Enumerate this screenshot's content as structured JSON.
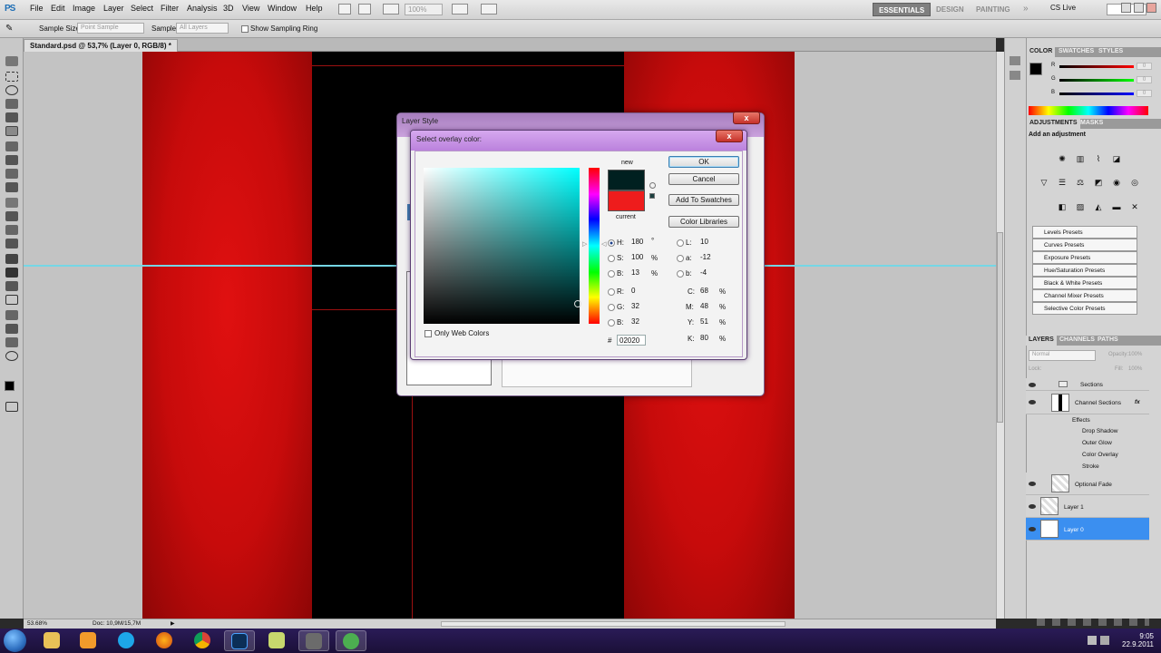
{
  "app": {
    "logo": "PS"
  },
  "menu": [
    "File",
    "Edit",
    "Image",
    "Layer",
    "Select",
    "Filter",
    "Analysis",
    "3D",
    "View",
    "Window",
    "Help"
  ],
  "menubar": {
    "zoom_value": "100%",
    "workspaces": [
      "ESSENTIALS",
      "DESIGN",
      "PAINTING"
    ],
    "more": "»",
    "cs_live": "CS Live"
  },
  "options": {
    "sample_size_label": "Sample Size:",
    "sample_size_value": "Point Sample",
    "sample_label": "Sample:",
    "sample_value": "All Layers",
    "show_ring_label": "Show Sampling Ring"
  },
  "document": {
    "tab": "Standard.psd @ 53,7% (Layer 0, RGB/8) *"
  },
  "status": {
    "zoom": "53.68%",
    "doc": "Doc: 10,9M/15,7M"
  },
  "panels": {
    "color_tabs": [
      "COLOR",
      "SWATCHES",
      "STYLES"
    ],
    "color_channels": [
      {
        "label": "R",
        "value": "0"
      },
      {
        "label": "G",
        "value": "0"
      },
      {
        "label": "B",
        "value": "0"
      }
    ],
    "adjustments_tabs": [
      "ADJUSTMENTS",
      "MASKS"
    ],
    "adjustments_title": "Add an adjustment",
    "presets": [
      "Levels Presets",
      "Curves Presets",
      "Exposure Presets",
      "Hue/Saturation Presets",
      "Black & White Presets",
      "Channel Mixer Presets",
      "Selective Color Presets"
    ],
    "layers_tabs": [
      "LAYERS",
      "CHANNELS",
      "PATHS"
    ],
    "blend_mode": "Normal",
    "opacity_label": "Opacity:",
    "opacity_value": "100%",
    "fill_label": "Fill:",
    "fill_value": "100%",
    "lock_label": "Lock:",
    "layers": {
      "group": "Sections",
      "channel_sections": "Channel Sections",
      "fx": "fx",
      "effects": "Effects",
      "effect_items": [
        "Drop Shadow",
        "Outer Glow",
        "Color Overlay",
        "Stroke"
      ],
      "optional_fade": "Optional Fade",
      "layer1": "Layer 1",
      "layer0": "Layer 0"
    }
  },
  "layer_style": {
    "title": "Layer Style",
    "close": "x",
    "blur_tab": "Color Overlay"
  },
  "picker": {
    "title": "Select overlay color:",
    "close": "x",
    "ok": "OK",
    "cancel": "Cancel",
    "add_swatches": "Add To Swatches",
    "color_libraries": "Color Libraries",
    "new_label": "new",
    "current_label": "current",
    "new_color": "#002020",
    "current_color": "#ee1c1c",
    "only_web": "Only Web Colors",
    "hsb": [
      {
        "label": "H:",
        "value": "180",
        "unit": "°"
      },
      {
        "label": "S:",
        "value": "100",
        "unit": "%"
      },
      {
        "label": "B:",
        "value": "13",
        "unit": "%"
      }
    ],
    "rgb": [
      {
        "label": "R:",
        "value": "0"
      },
      {
        "label": "G:",
        "value": "32"
      },
      {
        "label": "B:",
        "value": "32"
      }
    ],
    "lab": [
      {
        "label": "L:",
        "value": "10"
      },
      {
        "label": "a:",
        "value": "-12"
      },
      {
        "label": "b:",
        "value": "-4"
      }
    ],
    "cmyk": [
      {
        "label": "C:",
        "value": "68",
        "unit": "%"
      },
      {
        "label": "M:",
        "value": "48",
        "unit": "%"
      },
      {
        "label": "Y:",
        "value": "51",
        "unit": "%"
      },
      {
        "label": "K:",
        "value": "80",
        "unit": "%"
      }
    ],
    "hex_label": "#",
    "hex_value": "02020"
  },
  "taskbar": {
    "time": "9:05",
    "date": "22.9.2011"
  }
}
